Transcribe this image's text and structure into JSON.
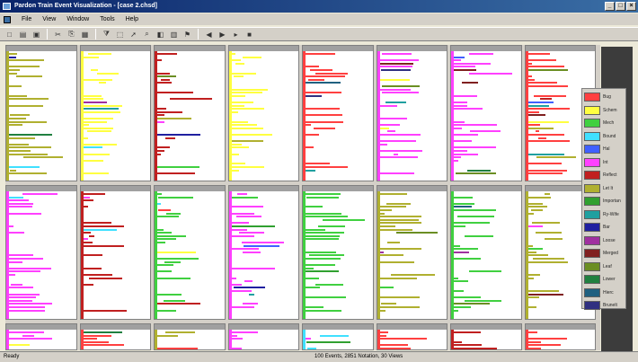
{
  "window": {
    "title": "Pardon Train Event Visualization - [case 2.chsd]",
    "buttons": {
      "minimize": "_",
      "maximize": "□",
      "close": "×"
    }
  },
  "menu": [
    "File",
    "View",
    "Window",
    "Tools",
    "Help"
  ],
  "toolbar_icons": [
    "new-icon",
    "open-icon",
    "save-icon",
    "cut-icon",
    "copy-icon",
    "paste-icon",
    "filter-icon",
    "select-icon",
    "pointer-icon",
    "zoom-icon",
    "color-icon",
    "chart-icon",
    "tag-icon",
    "back-icon",
    "forward-icon",
    "play-icon",
    "stop-icon"
  ],
  "legend": {
    "items": [
      {
        "label": "Bug",
        "color": "#ff4040"
      },
      {
        "label": "Schem",
        "color": "#ffff40"
      },
      {
        "label": "Mech",
        "color": "#40d040"
      },
      {
        "label": "Bound",
        "color": "#40e0ff"
      },
      {
        "label": "Hal",
        "color": "#4060ff"
      },
      {
        "label": "Int",
        "color": "#ff40ff"
      },
      {
        "label": "Reflect",
        "color": "#c02020"
      },
      {
        "label": "Let It",
        "color": "#b0b030"
      },
      {
        "label": "Importan",
        "color": "#30a030"
      },
      {
        "label": "Ry-Wife",
        "color": "#20a0a0"
      },
      {
        "label": "Bar",
        "color": "#2020a0"
      },
      {
        "label": "Loose",
        "color": "#a030a0"
      },
      {
        "label": "Merged",
        "color": "#802020"
      },
      {
        "label": "Leaf",
        "color": "#6b8e23"
      },
      {
        "label": "Lower",
        "color": "#208040"
      },
      {
        "label": "Hierc",
        "color": "#206080"
      },
      {
        "label": "Brunelt",
        "color": "#303080"
      }
    ]
  },
  "statusbar": {
    "ready": "Ready",
    "info": "100 Events, 2851 Notation, 30 Views"
  }
}
